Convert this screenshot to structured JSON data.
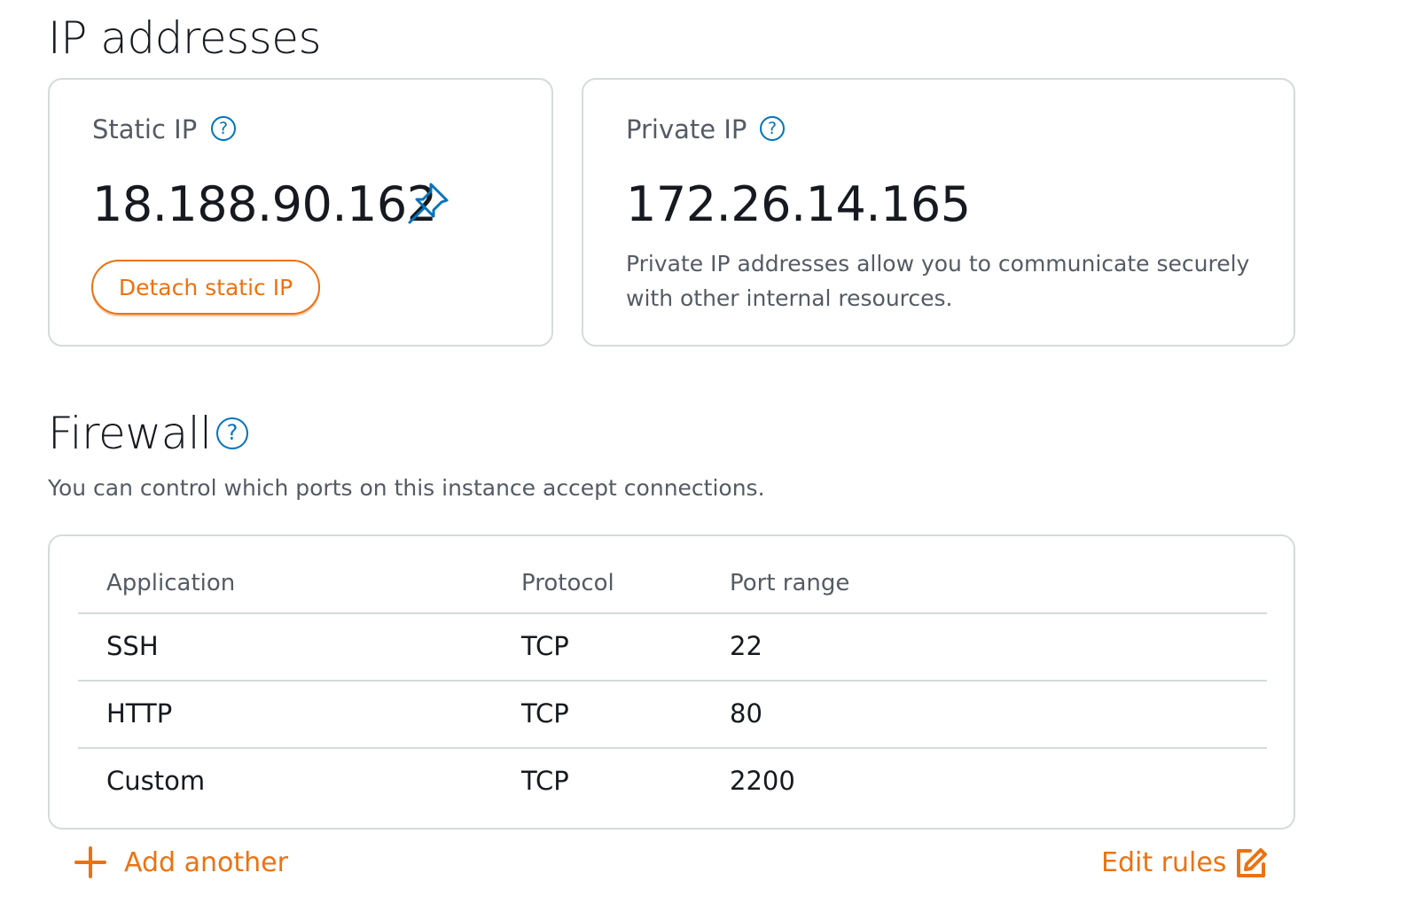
{
  "ip_section": {
    "title": "IP addresses",
    "static_ip": {
      "label": "Static IP",
      "help": "?",
      "value": "18.188.90.162",
      "detach_label": "Detach static IP"
    },
    "private_ip": {
      "label": "Private IP",
      "help": "?",
      "value": "172.26.14.165",
      "description": "Private IP addresses allow you to communicate securely with other internal resources."
    }
  },
  "firewall": {
    "title": "Firewall",
    "help": "?",
    "description": "You can control which ports on this instance accept connections.",
    "columns": [
      "Application",
      "Protocol",
      "Port range"
    ],
    "rows": [
      {
        "application": "SSH",
        "protocol": "TCP",
        "port_range": "22"
      },
      {
        "application": "HTTP",
        "protocol": "TCP",
        "port_range": "80"
      },
      {
        "application": "Custom",
        "protocol": "TCP",
        "port_range": "2200"
      }
    ],
    "add_label": "Add another",
    "edit_label": "Edit rules"
  },
  "icons": {
    "pin": "pin-icon",
    "help": "help-icon",
    "add": "plus-icon",
    "edit": "edit-icon"
  },
  "colors": {
    "accent": "#ec7211",
    "link_blue": "#0073bb",
    "pin_blue": "#0073bb",
    "text_primary": "#16191f",
    "text_secondary": "#545b64",
    "border": "#d5dbdb"
  }
}
